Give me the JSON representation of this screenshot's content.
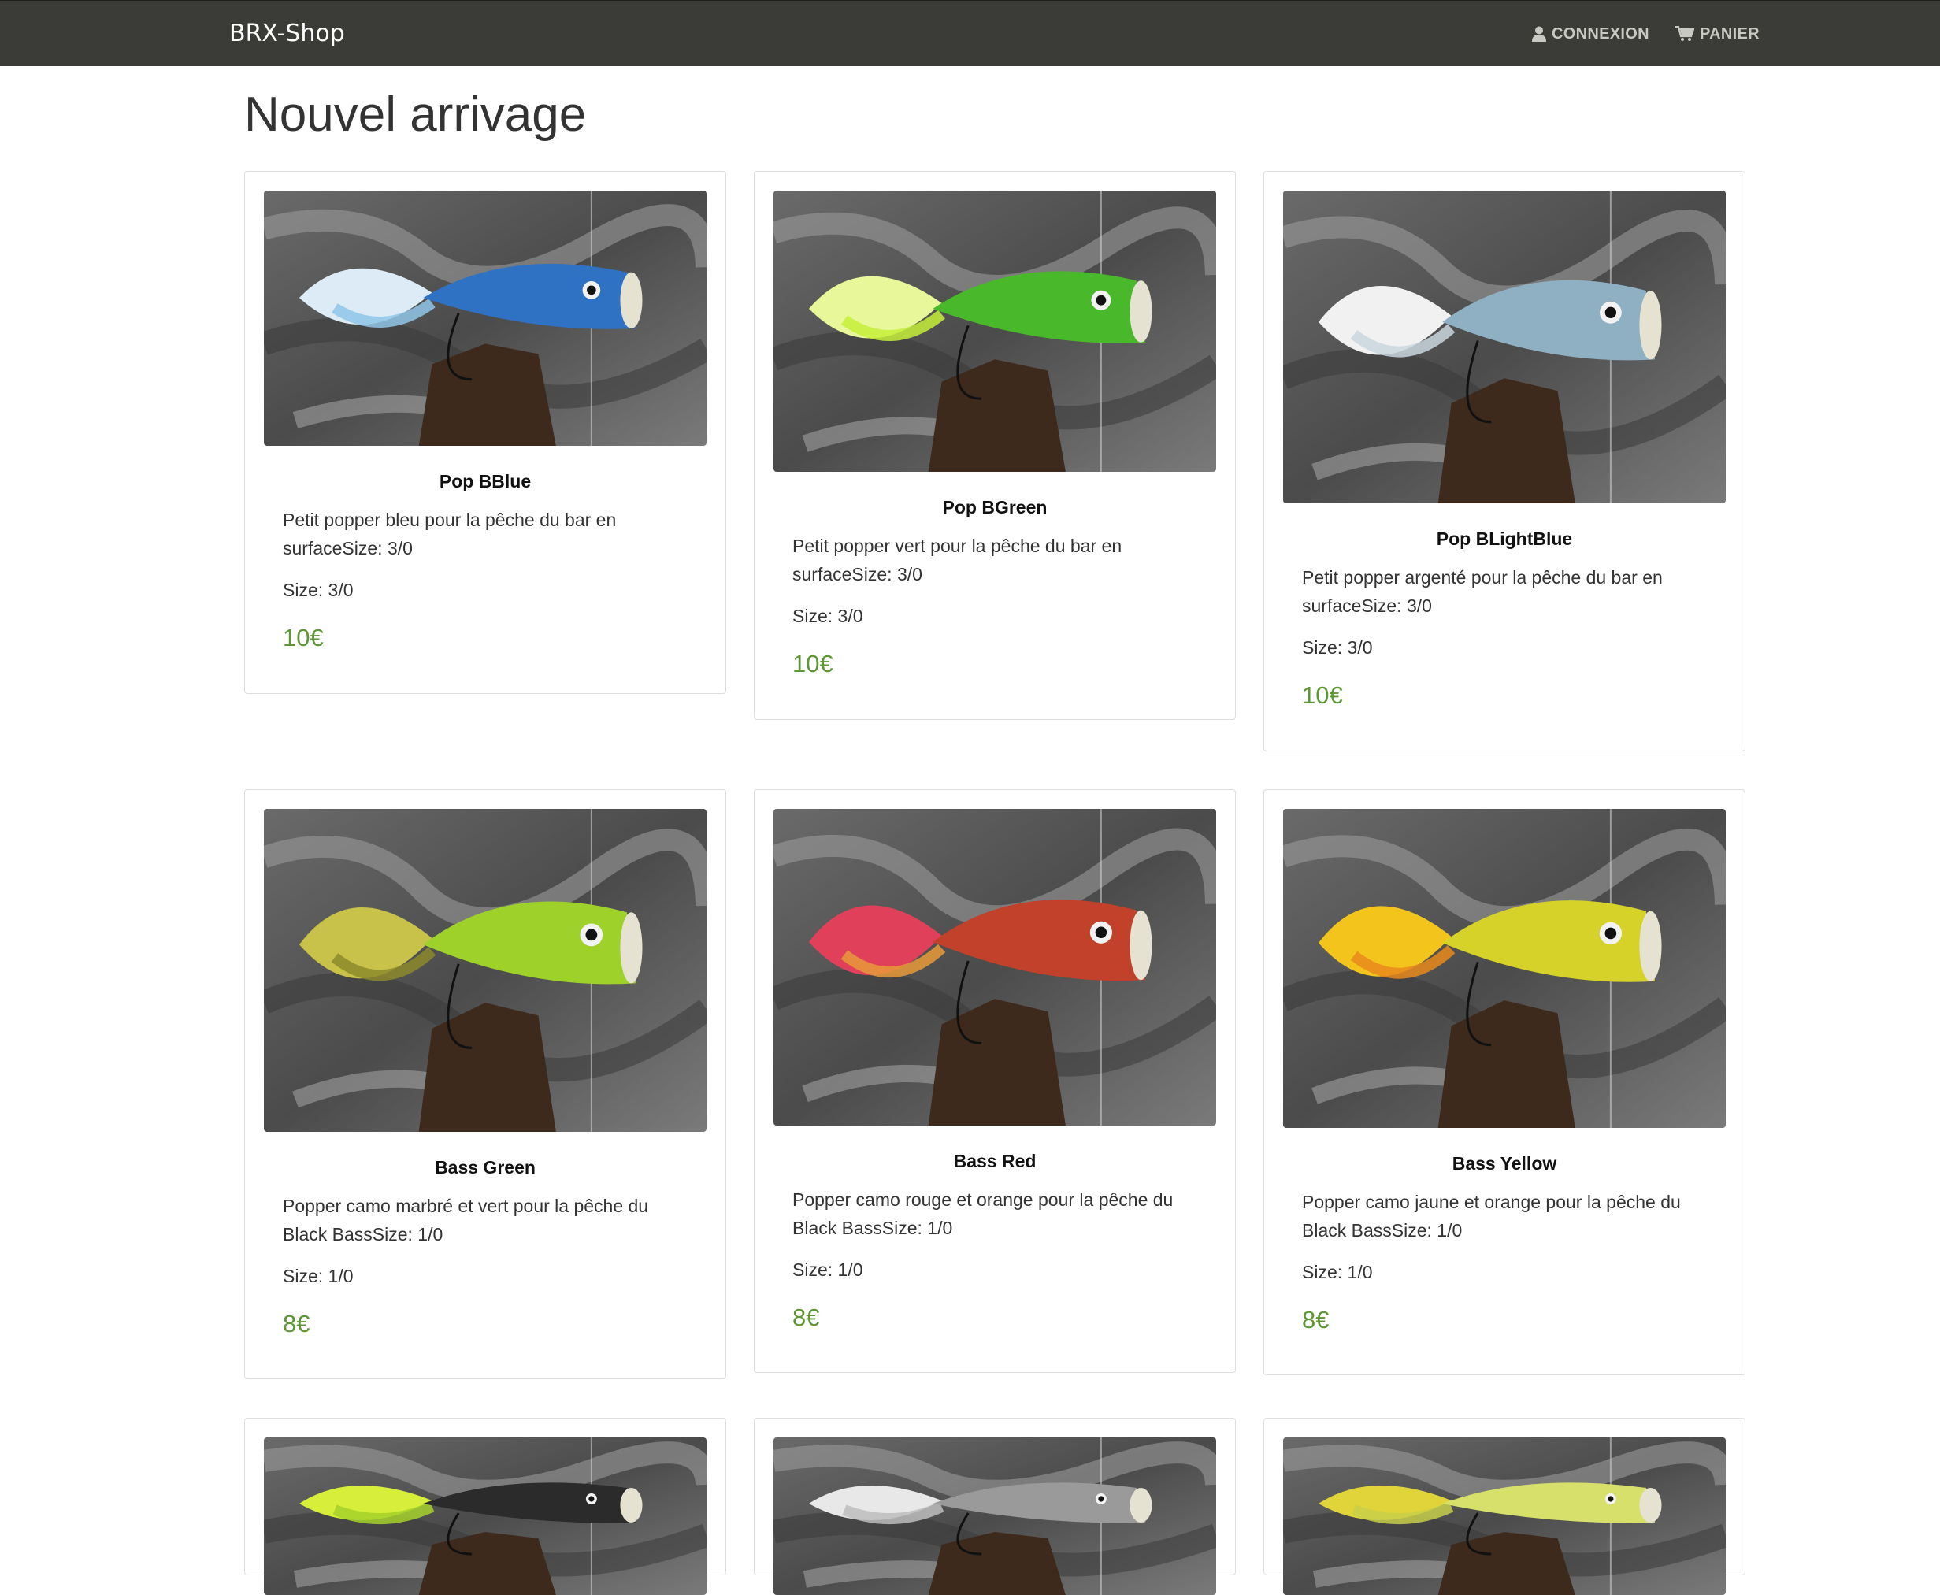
{
  "navbar": {
    "brand": "BRX-Shop",
    "login_label": "CONNEXION",
    "login_icon": "user-icon",
    "cart_label": "PANIER",
    "cart_icon": "cart-icon"
  },
  "page": {
    "title": "Nouvel arrivage"
  },
  "products": [
    {
      "name": "Pop BBlue",
      "description": "Petit popper bleu pour la pêche du bar en surfaceSize: 3/0",
      "size": "Size: 3/0",
      "price": "10€",
      "body_color": "#2f72c4",
      "feather_color": "#dcebf5",
      "accent": "#8fc5e8"
    },
    {
      "name": "Pop BGreen",
      "description": "Petit popper vert pour la pêche du bar en surfaceSize: 3/0",
      "size": "Size: 3/0",
      "price": "10€",
      "body_color": "#49b82a",
      "feather_color": "#e8f79a",
      "accent": "#c6ef3a"
    },
    {
      "name": "Pop BLightBlue",
      "description": "Petit popper argenté pour la pêche du bar en surfaceSize: 3/0",
      "size": "Size: 3/0",
      "price": "10€",
      "body_color": "#8eb0c2",
      "feather_color": "#f1f1f1",
      "accent": "#c9d6de"
    },
    {
      "name": "Bass Green",
      "description": "Popper camo marbré et vert pour la pêche du Black BassSize: 1/0",
      "size": "Size: 1/0",
      "price": "8€",
      "body_color": "#9ed12a",
      "feather_color": "#c8c24a",
      "accent": "#8c8a2c"
    },
    {
      "name": "Bass Red",
      "description": "Popper camo rouge et orange pour la pêche du Black BassSize: 1/0",
      "size": "Size: 1/0",
      "price": "8€",
      "body_color": "#c2412a",
      "feather_color": "#e0405a",
      "accent": "#e89a3a"
    },
    {
      "name": "Bass Yellow",
      "description": "Popper camo jaune et orange pour la pêche du Black BassSize: 1/0",
      "size": "Size: 1/0",
      "price": "8€",
      "body_color": "#d7d22a",
      "feather_color": "#f3c51c",
      "accent": "#e7881c"
    },
    {
      "name": "",
      "description": "",
      "size": "",
      "price": "",
      "body_color": "#2b2b2b",
      "feather_color": "#d7ef3a",
      "accent": "#a6d12c"
    },
    {
      "name": "",
      "description": "",
      "size": "",
      "price": "",
      "body_color": "#9a9a9a",
      "feather_color": "#e8e8e8",
      "accent": "#bdbdbd"
    },
    {
      "name": "",
      "description": "",
      "size": "",
      "price": "",
      "body_color": "#d7e06a",
      "feather_color": "#e1d43a",
      "accent": "#c8cf4a"
    }
  ]
}
